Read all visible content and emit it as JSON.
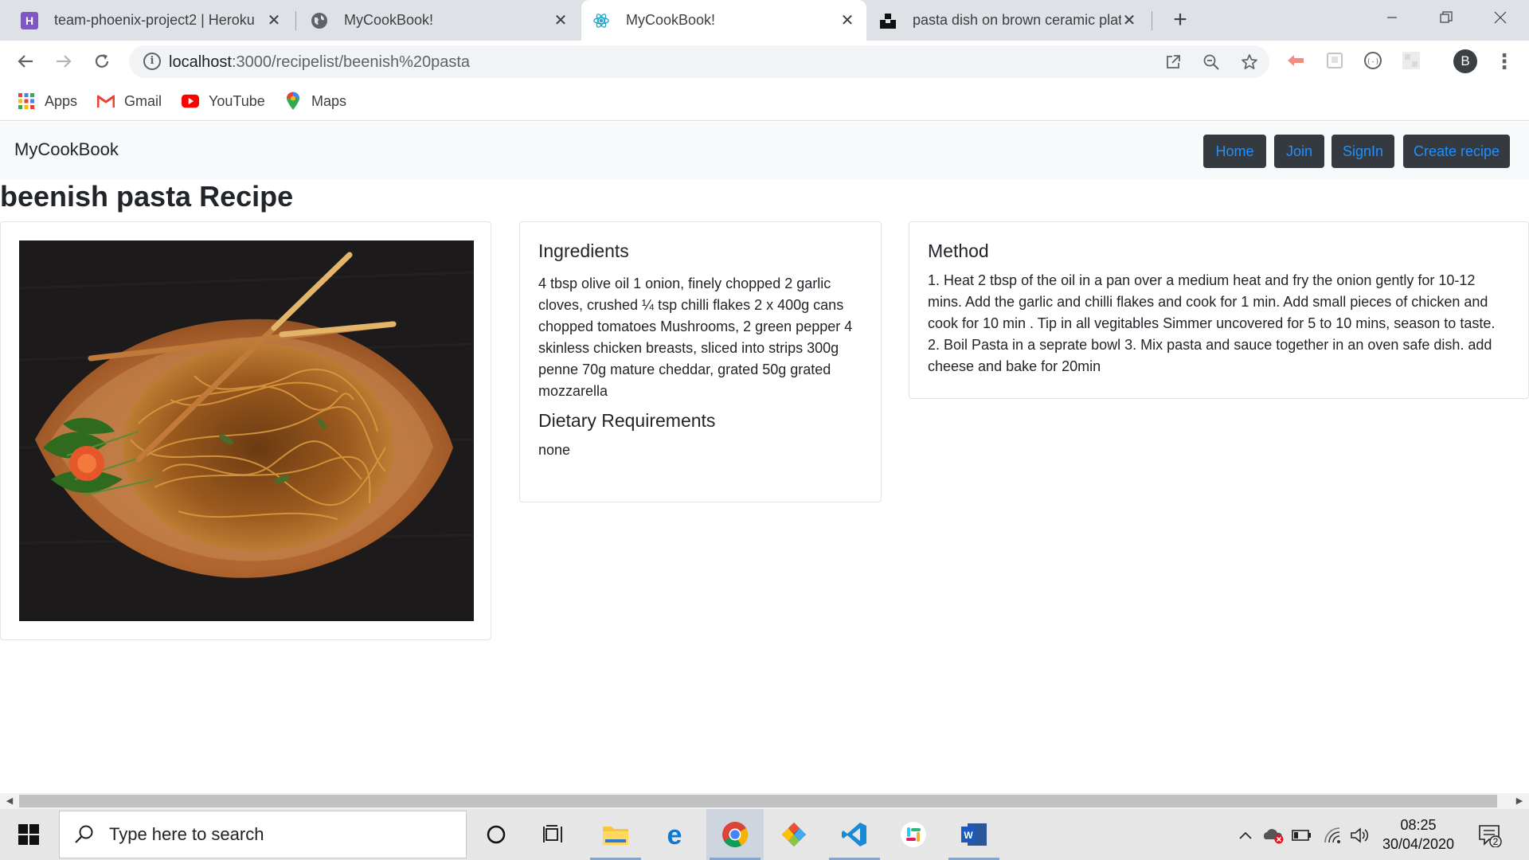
{
  "browser": {
    "tabs": [
      {
        "title": "team-phoenix-project2 | Heroku",
        "icon": "heroku-icon",
        "active": false
      },
      {
        "title": "MyCookBook!",
        "icon": "globe-icon",
        "active": false
      },
      {
        "title": "MyCookBook!",
        "icon": "react-icon",
        "active": true
      },
      {
        "title": "pasta dish on brown ceramic plat",
        "icon": "unsplash-icon",
        "active": false
      }
    ],
    "new_tab": "+",
    "url_host": "localhost",
    "url_rest": ":3000/recipelist/beenish%20pasta",
    "profile_initial": "B",
    "bookmarks": [
      {
        "label": "Apps",
        "icon": "apps-grid-icon"
      },
      {
        "label": "Gmail",
        "icon": "gmail-icon"
      },
      {
        "label": "YouTube",
        "icon": "youtube-icon"
      },
      {
        "label": "Maps",
        "icon": "maps-icon"
      }
    ]
  },
  "site": {
    "brand": "MyCookBook",
    "nav": [
      "Home",
      "Join",
      "SignIn",
      "Create recipe"
    ],
    "link_color": "#1e90ff"
  },
  "recipe": {
    "title": "beenish pasta Recipe",
    "image_alt": "pasta dish on brown ceramic plate",
    "ingredients_heading": "Ingredients",
    "ingredients": "4 tbsp olive oil 1 onion, finely chopped 2 garlic cloves, crushed ¼ tsp chilli flakes 2 x 400g cans chopped tomatoes Mushrooms, 2 green pepper 4 skinless chicken breasts, sliced into strips 300g penne 70g mature cheddar, grated 50g grated mozzarella",
    "dietary_heading": "Dietary Requirements",
    "dietary": "none",
    "method_heading": "Method",
    "method": "1. Heat 2 tbsp of the oil in a pan over a medium heat and fry the onion gently for 10-12 mins. Add the garlic and chilli flakes and cook for 1 min. Add small pieces of chicken and cook for 10 min . Tip in all vegitables Simmer uncovered for 5 to 10 mins, season to taste. 2. Boil Pasta in a seprate bowl 3. Mix pasta and sauce together in an oven safe dish. add cheese and bake for 20min"
  },
  "taskbar": {
    "search_placeholder": "Type here to search",
    "time": "08:25",
    "date": "30/04/2020",
    "notification_count": "2"
  }
}
